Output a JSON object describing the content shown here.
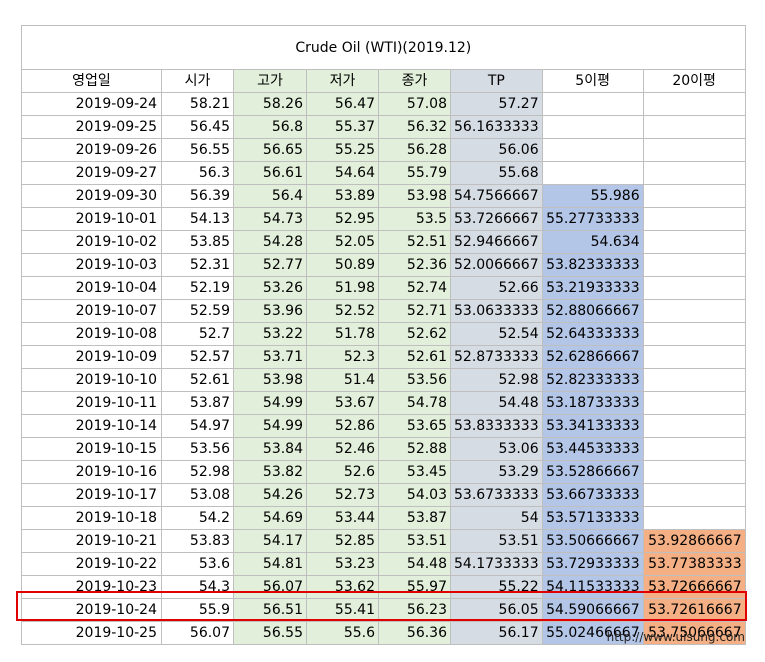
{
  "title": "Crude Oil (WTI)(2019.12)",
  "headers": [
    "영업일",
    "시가",
    "고가",
    "저가",
    "종가",
    "TP",
    "5이평",
    "20이평"
  ],
  "rows": [
    [
      "2019-09-24",
      "58.21",
      "58.26",
      "56.47",
      "57.08",
      "57.27",
      "",
      ""
    ],
    [
      "2019-09-25",
      "56.45",
      "56.8",
      "55.37",
      "56.32",
      "56.1633333",
      "",
      ""
    ],
    [
      "2019-09-26",
      "56.55",
      "56.65",
      "55.25",
      "56.28",
      "56.06",
      "",
      ""
    ],
    [
      "2019-09-27",
      "56.3",
      "56.61",
      "54.64",
      "55.79",
      "55.68",
      "",
      ""
    ],
    [
      "2019-09-30",
      "56.39",
      "56.4",
      "53.89",
      "53.98",
      "54.7566667",
      "55.986",
      ""
    ],
    [
      "2019-10-01",
      "54.13",
      "54.73",
      "52.95",
      "53.5",
      "53.7266667",
      "55.27733333",
      ""
    ],
    [
      "2019-10-02",
      "53.85",
      "54.28",
      "52.05",
      "52.51",
      "52.9466667",
      "54.634",
      ""
    ],
    [
      "2019-10-03",
      "52.31",
      "52.77",
      "50.89",
      "52.36",
      "52.0066667",
      "53.82333333",
      ""
    ],
    [
      "2019-10-04",
      "52.19",
      "53.26",
      "51.98",
      "52.74",
      "52.66",
      "53.21933333",
      ""
    ],
    [
      "2019-10-07",
      "52.59",
      "53.96",
      "52.52",
      "52.71",
      "53.0633333",
      "52.88066667",
      ""
    ],
    [
      "2019-10-08",
      "52.7",
      "53.22",
      "51.78",
      "52.62",
      "52.54",
      "52.64333333",
      ""
    ],
    [
      "2019-10-09",
      "52.57",
      "53.71",
      "52.3",
      "52.61",
      "52.8733333",
      "52.62866667",
      ""
    ],
    [
      "2019-10-10",
      "52.61",
      "53.98",
      "51.4",
      "53.56",
      "52.98",
      "52.82333333",
      ""
    ],
    [
      "2019-10-11",
      "53.87",
      "54.99",
      "53.67",
      "54.78",
      "54.48",
      "53.18733333",
      ""
    ],
    [
      "2019-10-14",
      "54.97",
      "54.99",
      "52.86",
      "53.65",
      "53.8333333",
      "53.34133333",
      ""
    ],
    [
      "2019-10-15",
      "53.56",
      "53.84",
      "52.46",
      "52.88",
      "53.06",
      "53.44533333",
      ""
    ],
    [
      "2019-10-16",
      "52.98",
      "53.82",
      "52.6",
      "53.45",
      "53.29",
      "53.52866667",
      ""
    ],
    [
      "2019-10-17",
      "53.08",
      "54.26",
      "52.73",
      "54.03",
      "53.6733333",
      "53.66733333",
      ""
    ],
    [
      "2019-10-18",
      "54.2",
      "54.69",
      "53.44",
      "53.87",
      "54",
      "53.57133333",
      ""
    ],
    [
      "2019-10-21",
      "53.83",
      "54.17",
      "52.85",
      "53.51",
      "53.51",
      "53.50666667",
      "53.92866667"
    ],
    [
      "2019-10-22",
      "53.6",
      "54.81",
      "53.23",
      "54.48",
      "54.1733333",
      "53.72933333",
      "53.77383333"
    ],
    [
      "2019-10-23",
      "54.3",
      "56.07",
      "53.62",
      "55.97",
      "55.22",
      "54.11533333",
      "53.72666667"
    ],
    [
      "2019-10-24",
      "55.9",
      "56.51",
      "55.41",
      "56.23",
      "56.05",
      "54.59066667",
      "53.72616667"
    ],
    [
      "2019-10-25",
      "56.07",
      "56.55",
      "55.6",
      "56.36",
      "56.17",
      "55.02466667",
      "53.75066667"
    ]
  ],
  "highlighted_row_index": 23,
  "source": "http://www.uisung.com",
  "colors": {
    "price_fill": "#e2efda",
    "tp_fill": "#d6dce4",
    "ma5_fill": "#b4c6e7",
    "ma20_fill": "#f4b084",
    "highlight_border": "#e00000",
    "grid": "#bfbfbf"
  }
}
